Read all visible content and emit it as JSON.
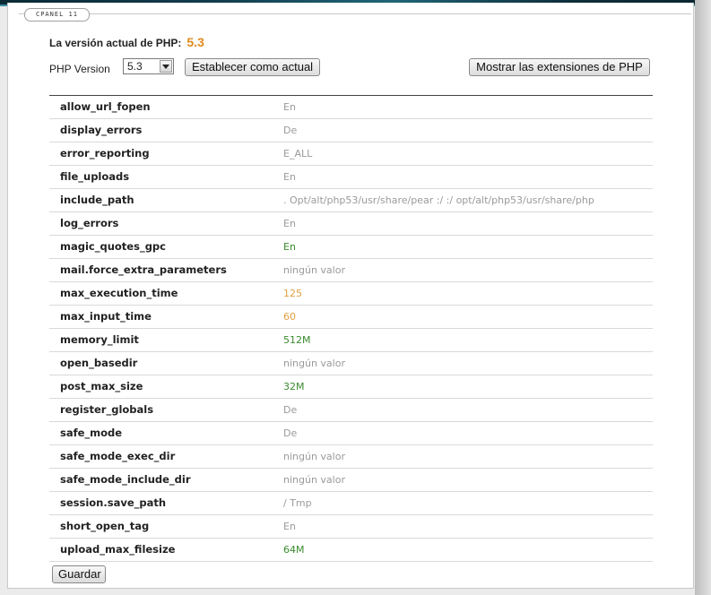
{
  "header": {
    "badge": "CPANEL 11"
  },
  "version": {
    "label": "La versión actual de PHP:",
    "value": "5.3"
  },
  "selector": {
    "label": "PHP Version",
    "selected": "5.3"
  },
  "buttons": {
    "set_current": "Establecer como actual",
    "show_extensions": "Mostrar las extensiones de PHP",
    "save": "Guardar"
  },
  "colors": {
    "default": "#9a9a9a",
    "green": "#3a8a2e",
    "orange": "#e0a040",
    "accent": "#e08a1c"
  },
  "settings": [
    {
      "key": "allow_url_fopen",
      "value": "En",
      "color": "default"
    },
    {
      "key": "display_errors",
      "value": "De",
      "color": "default"
    },
    {
      "key": "error_reporting",
      "value": "E_ALL",
      "color": "default"
    },
    {
      "key": "file_uploads",
      "value": "En",
      "color": "default"
    },
    {
      "key": "include_path",
      "value": ". Opt/alt/php53/usr/share/pear :/ :/ opt/alt/php53/usr/share/php",
      "color": "default"
    },
    {
      "key": "log_errors",
      "value": "En",
      "color": "default"
    },
    {
      "key": "magic_quotes_gpc",
      "value": "En",
      "color": "green"
    },
    {
      "key": "mail.force_extra_parameters",
      "value": "ningún valor",
      "color": "default"
    },
    {
      "key": "max_execution_time",
      "value": "125",
      "color": "orange"
    },
    {
      "key": "max_input_time",
      "value": "60",
      "color": "orange"
    },
    {
      "key": "memory_limit",
      "value": "512M",
      "color": "green"
    },
    {
      "key": "open_basedir",
      "value": "ningún valor",
      "color": "default"
    },
    {
      "key": "post_max_size",
      "value": "32M",
      "color": "green"
    },
    {
      "key": "register_globals",
      "value": "De",
      "color": "default"
    },
    {
      "key": "safe_mode",
      "value": "De",
      "color": "default"
    },
    {
      "key": "safe_mode_exec_dir",
      "value": "ningún valor",
      "color": "default"
    },
    {
      "key": "safe_mode_include_dir",
      "value": "ningún valor",
      "color": "default"
    },
    {
      "key": "session.save_path",
      "value": "/ Tmp",
      "color": "default"
    },
    {
      "key": "short_open_tag",
      "value": "En",
      "color": "default"
    },
    {
      "key": "upload_max_filesize",
      "value": "64M",
      "color": "green"
    }
  ]
}
